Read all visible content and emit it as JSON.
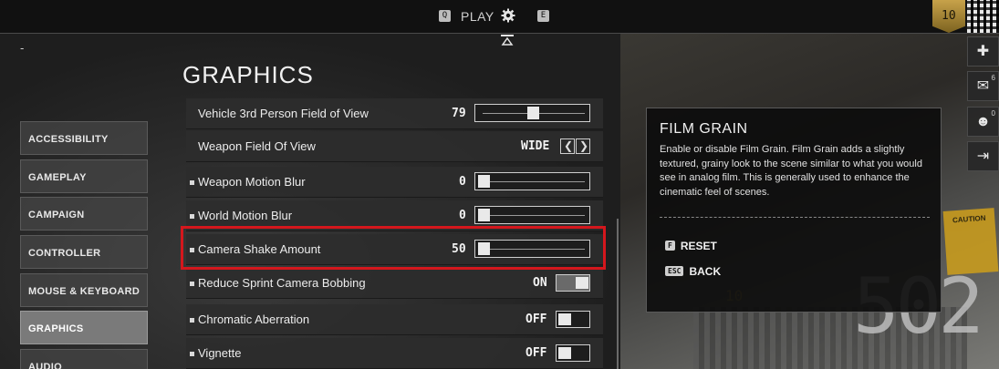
{
  "topbar": {
    "left_key": "Q",
    "play_label": "PLAY",
    "right_key": "E",
    "rank": "10"
  },
  "dash_mark": "-",
  "page_title": "GRAPHICS",
  "nav": {
    "items": [
      {
        "label": "ACCESSIBILITY"
      },
      {
        "label": "GAMEPLAY"
      },
      {
        "label": "CAMPAIGN"
      },
      {
        "label": "CONTROLLER"
      },
      {
        "label": "MOUSE & KEYBOARD"
      },
      {
        "label": "GRAPHICS"
      },
      {
        "label": "AUDIO"
      }
    ],
    "active": "GRAPHICS"
  },
  "settings": [
    {
      "label": "Vehicle 3rd Person Field of View",
      "value": "79",
      "type": "slider",
      "level": 0.5
    },
    {
      "label": "Weapon Field Of View",
      "value": "WIDE",
      "type": "selector"
    },
    {
      "label": "Weapon Motion Blur",
      "value": "0",
      "type": "slider",
      "level": 0.0
    },
    {
      "label": "World Motion Blur",
      "value": "0",
      "type": "slider",
      "level": 0.0
    },
    {
      "label": "Camera Shake Amount",
      "value": "50",
      "type": "slider",
      "level": 0.0
    },
    {
      "label": "Reduce Sprint Camera Bobbing",
      "value": "ON",
      "type": "toggle",
      "on": true
    },
    {
      "label": "Chromatic Aberration",
      "value": "OFF",
      "type": "toggle",
      "on": false
    },
    {
      "label": "Vignette",
      "value": "OFF",
      "type": "toggle",
      "on": false
    }
  ],
  "info": {
    "title": "FILM GRAIN",
    "body": "Enable or disable Film Grain. Film Grain adds a slightly textured, grainy look to the scene similar to what you would see in analog film. This is generally used to enhance the cinematic feel of scenes.",
    "reset_key": "F",
    "reset_label": "RESET",
    "back_key": "ESC",
    "back_label": "BACK"
  },
  "side": {
    "mail_count": "6",
    "group_count": "0"
  },
  "background": {
    "big_number": "502",
    "small_number": "10"
  },
  "colors": {
    "highlight": "#d4171d",
    "rank_gold": "#c7a24a"
  }
}
